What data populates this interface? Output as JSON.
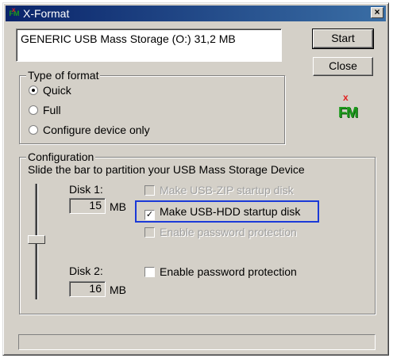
{
  "window": {
    "title": "X-Format",
    "close_label": "×"
  },
  "device": {
    "label": "GENERIC USB Mass Storage (O:)  31,2 MB"
  },
  "buttons": {
    "start": "Start",
    "close": "Close"
  },
  "format_type": {
    "legend": "Type of format",
    "options": [
      {
        "label": "Quick",
        "checked": true
      },
      {
        "label": "Full",
        "checked": false
      },
      {
        "label": "Configure device only",
        "checked": false
      }
    ]
  },
  "logo": {
    "x": "x",
    "fm": "FM"
  },
  "configuration": {
    "legend": "Configuration",
    "description": "Slide the bar to partition your USB Mass Storage Device",
    "disk1": {
      "label": "Disk 1:",
      "size": "15",
      "unit": "MB",
      "options": [
        {
          "label": "Make USB-ZIP startup disk",
          "checked": false,
          "enabled": false
        },
        {
          "label": "Make USB-HDD startup disk",
          "checked": true,
          "enabled": true
        },
        {
          "label": "Enable password protection",
          "checked": false,
          "enabled": false
        }
      ]
    },
    "disk2": {
      "label": "Disk 2:",
      "size": "16",
      "unit": "MB",
      "options": [
        {
          "label": "Enable password protection",
          "checked": false,
          "enabled": true
        }
      ]
    },
    "slider_fraction": 0.48
  },
  "progress": {
    "fraction": 0
  },
  "colors": {
    "face": "#d4d0c8",
    "titlebar": "#0a246a",
    "highlight_box": "#1a39d8"
  }
}
